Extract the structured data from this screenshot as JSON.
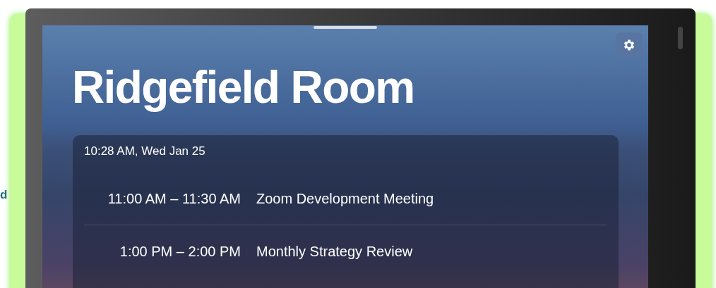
{
  "page_fragment": "d",
  "room": {
    "title": "Ridgefield Room"
  },
  "schedule": {
    "current_time": "10:28 AM, Wed Jan 25",
    "events": [
      {
        "time": "11:00 AM – 11:30 AM",
        "title": "Zoom Development Meeting"
      },
      {
        "time": "1:00 PM – 2:00 PM",
        "title": "Monthly Strategy Review"
      }
    ]
  }
}
